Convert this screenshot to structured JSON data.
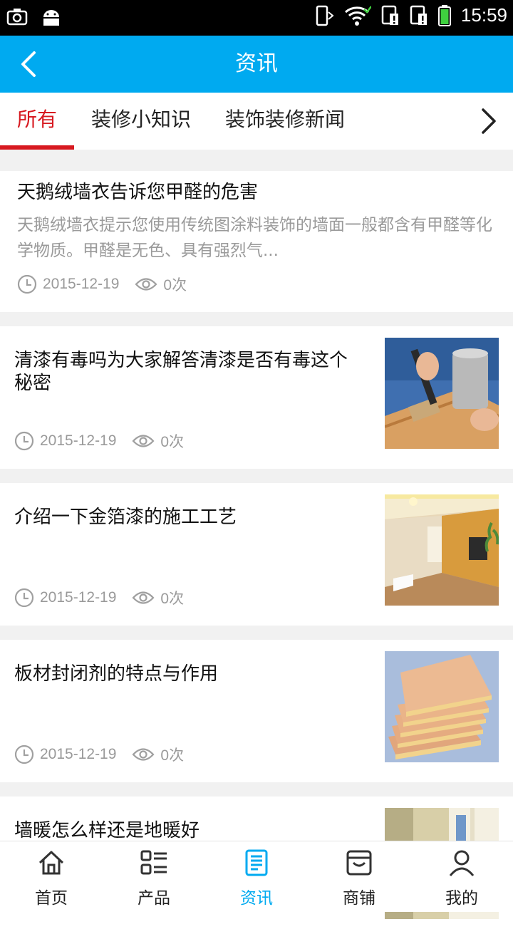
{
  "status_bar": {
    "time": "15:59"
  },
  "header": {
    "title": "资讯"
  },
  "tabs": [
    {
      "label": "所有"
    },
    {
      "label": "装修小知识"
    },
    {
      "label": "装饰装修新闻"
    }
  ],
  "articles": [
    {
      "title": "天鹅绒墙衣告诉您甲醛的危害",
      "summary": " 天鹅绒墙衣提示您使用传统图涂料装饰的墙面一般都含有甲醛等化学物质。甲醛是无色、具有强烈气...",
      "date": "2015-12-19",
      "views": "0次"
    },
    {
      "title": "清漆有毒吗为大家解答清漆是否有毒这个秘密",
      "date": "2015-12-19",
      "views": "0次"
    },
    {
      "title": "介绍一下金箔漆的施工工艺",
      "date": "2015-12-19",
      "views": "0次"
    },
    {
      "title": "板材封闭剂的特点与作用",
      "date": "2015-12-19",
      "views": "0次"
    },
    {
      "title": "墙暖怎么样还是地暖好"
    }
  ],
  "bottom_nav": [
    {
      "label": "首页",
      "icon": "home-icon"
    },
    {
      "label": "产品",
      "icon": "list-icon"
    },
    {
      "label": "资讯",
      "icon": "news-icon"
    },
    {
      "label": "商铺",
      "icon": "store-icon"
    },
    {
      "label": "我的",
      "icon": "user-icon"
    }
  ],
  "colors": {
    "accent": "#00aaf0",
    "active_tab": "#d71920"
  }
}
